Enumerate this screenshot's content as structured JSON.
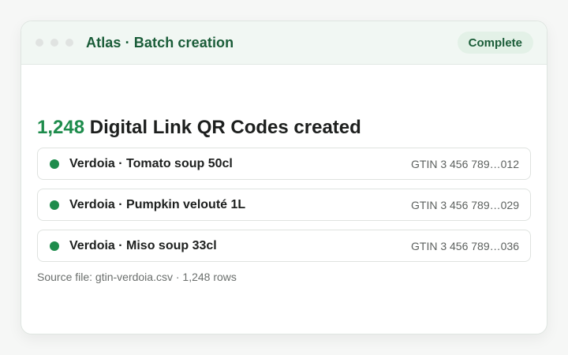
{
  "window": {
    "title": "Atlas · Batch creation",
    "status": "Complete"
  },
  "result": {
    "count": "1,248",
    "heading_rest": " Digital Link QR Codes created",
    "items": [
      {
        "label": "Verdoia · Tomato soup 50cl",
        "gtin": "GTIN 3 456 789…012"
      },
      {
        "label": "Verdoia · Pumpkin velouté 1L",
        "gtin": "GTIN 3 456 789…029"
      },
      {
        "label": "Verdoia · Miso soup 33cl",
        "gtin": "GTIN 3 456 789…036"
      }
    ],
    "source": "Source file: gtin-verdoia.csv · 1,248 rows"
  },
  "colors": {
    "accent": "#1e8c4c",
    "title": "#1a5c38",
    "badge_bg": "#e3f1e7"
  }
}
